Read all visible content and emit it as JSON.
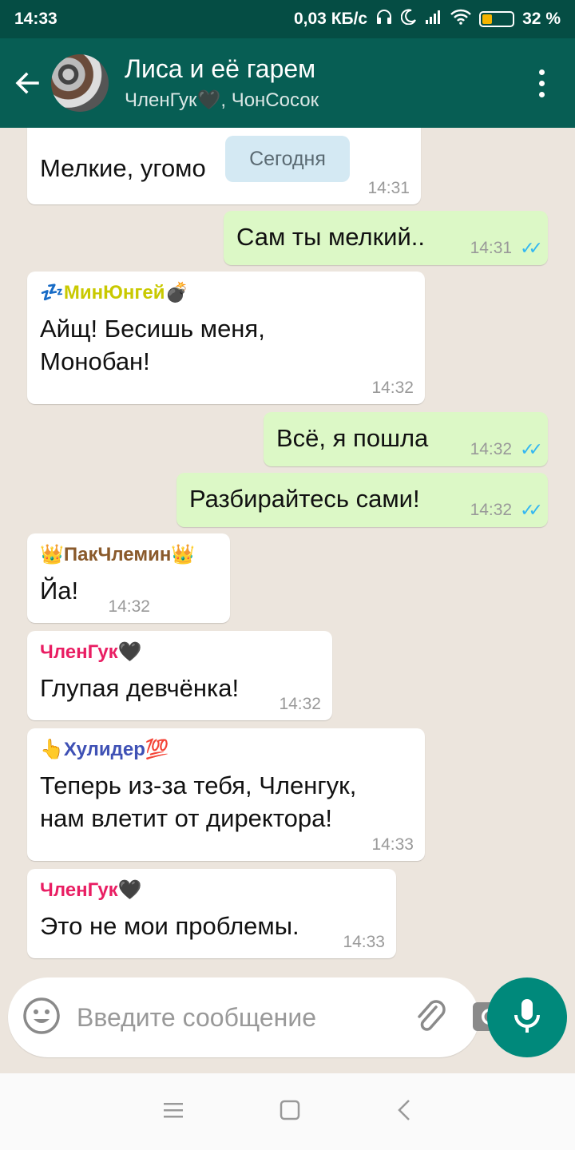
{
  "status_bar": {
    "time": "14:33",
    "speed": "0,03 КБ/с",
    "battery": "32 %",
    "battery_level": 0.32
  },
  "header": {
    "title": "Лиса и её гарем",
    "subtitle": "ЧленГук🖤, ЧонСосок",
    "icons": {
      "back": "arrow-back-icon",
      "menu": "more-vert-icon"
    }
  },
  "date_separator": "Сегодня",
  "messages": [
    {
      "direction": "in",
      "sender": "",
      "text": "Мелкие, угомо",
      "time": "14:31"
    },
    {
      "direction": "out",
      "text": "Сам ты мелкий..",
      "time": "14:31"
    },
    {
      "direction": "in",
      "sender": "💤МинЮнгей💣",
      "text": "Айщ! Бесишь меня, Монобан!",
      "time": "14:32"
    },
    {
      "direction": "out",
      "text": "Всё, я пошла",
      "time": "14:32"
    },
    {
      "direction": "out",
      "text": "Разбирайтесь сами!",
      "time": "14:32"
    },
    {
      "direction": "in",
      "sender": "👑ПакЧлемин👑",
      "text": "Йа!",
      "time": "14:32"
    },
    {
      "direction": "in",
      "sender": "ЧленГук🖤",
      "text": "Глупая девчёнка!",
      "time": "14:32"
    },
    {
      "direction": "in",
      "sender": "👆Хулидер💯",
      "text": "Теперь из-за тебя, Членгук, нам влетит от директора!",
      "time": "14:33"
    },
    {
      "direction": "in",
      "sender": "ЧленГук🖤",
      "text": "Это не мои проблемы.",
      "time": "14:33"
    }
  ],
  "input": {
    "placeholder": "Введите сообщение",
    "icons": {
      "emoji": "emoji-icon",
      "attach": "paperclip-icon",
      "camera": "camera-icon",
      "mic": "mic-icon"
    }
  },
  "nav_bar": {
    "icons": [
      "menu-icon",
      "home-square-icon",
      "back-triangle-icon"
    ]
  },
  "colors": {
    "header": "#075e54",
    "status_bar": "#054d44",
    "chat_bg": "#ece5dd",
    "outgoing_bubble": "#dcf8c6",
    "incoming_bubble": "#ffffff",
    "sender_minyungey": "#c9c900",
    "sender_pakchlemin": "#8a5a2b",
    "sender_chlenguk": "#e91e63",
    "sender_hulider": "#3f51b5",
    "mic_button": "#00897b",
    "read_ticks": "#34b7f1"
  }
}
